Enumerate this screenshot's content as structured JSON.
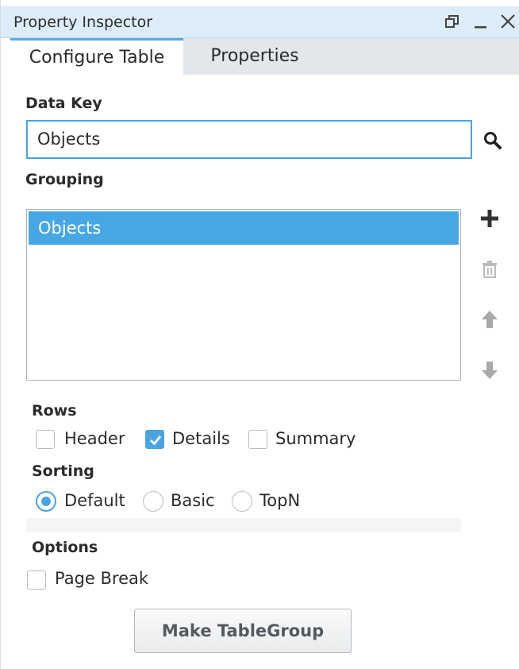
{
  "window": {
    "title": "Property Inspector",
    "controls": [
      "restore-icon",
      "minimize-icon",
      "close-icon"
    ]
  },
  "tabs": [
    {
      "label": "Configure Table",
      "active": true
    },
    {
      "label": "Properties",
      "active": false
    }
  ],
  "data_key": {
    "label": "Data Key",
    "value": "Objects",
    "search_icon": "search-icon"
  },
  "grouping": {
    "label": "Grouping",
    "items": [
      {
        "label": "Objects",
        "selected": true
      }
    ],
    "actions": [
      "add-icon",
      "delete-icon",
      "move-up-icon",
      "move-down-icon"
    ]
  },
  "rows": {
    "label": "Rows",
    "options": [
      {
        "label": "Header",
        "checked": false
      },
      {
        "label": "Details",
        "checked": true
      },
      {
        "label": "Summary",
        "checked": false
      }
    ]
  },
  "sorting": {
    "label": "Sorting",
    "options": [
      {
        "label": "Default",
        "selected": true
      },
      {
        "label": "Basic",
        "selected": false
      },
      {
        "label": "TopN",
        "selected": false
      }
    ]
  },
  "options": {
    "label": "Options",
    "page_break": {
      "label": "Page Break",
      "checked": false
    }
  },
  "make_button": {
    "label": "Make TableGroup"
  },
  "colors": {
    "accent": "#4aa3e0",
    "selection": "#47a7e4",
    "titlebar": "#dcedf9"
  }
}
